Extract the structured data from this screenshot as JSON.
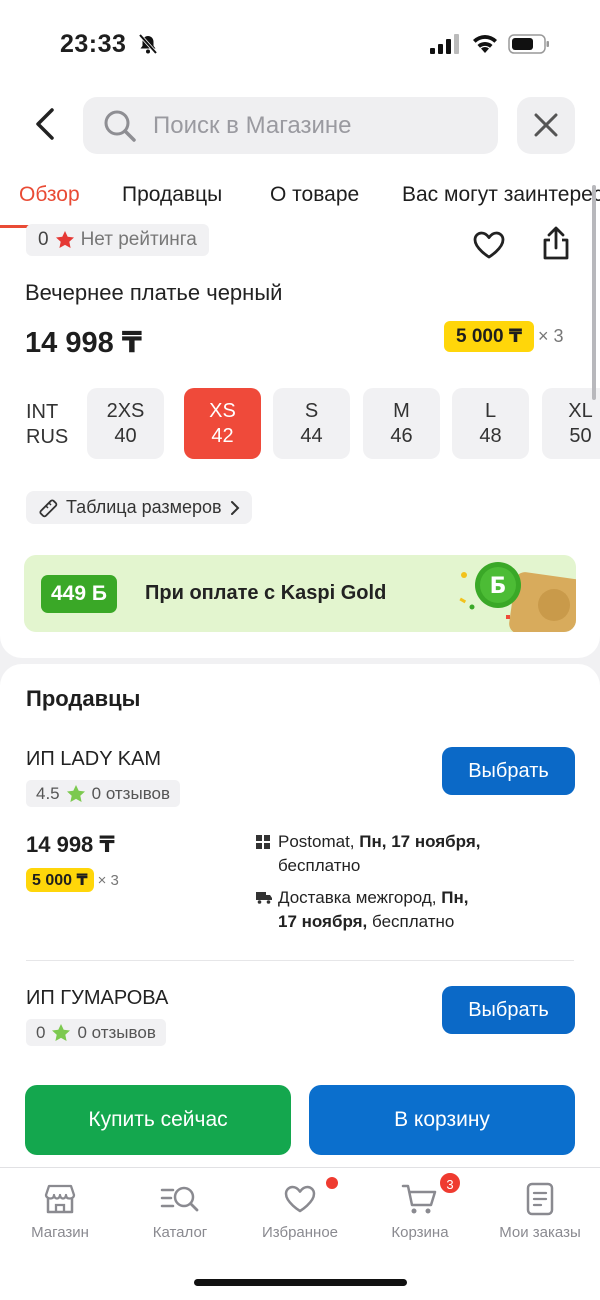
{
  "status_bar": {
    "time": "23:33"
  },
  "header": {
    "search_placeholder": "Поиск в Магазине"
  },
  "tabs": [
    {
      "label": "Обзор",
      "active": true
    },
    {
      "label": "Продавцы",
      "active": false
    },
    {
      "label": "О товаре",
      "active": false
    },
    {
      "label": "Вас могут заинтересовать",
      "active": false
    }
  ],
  "product": {
    "rating_count": "0",
    "rating_text": "Нет рейтинга",
    "title": "Вечернее платье черный",
    "price": "14 998 ₸",
    "installment_amount": "5 000 ₸",
    "installment_months": "× 3",
    "size_label_int": "INT",
    "size_label_rus": "RUS",
    "sizes": [
      {
        "int": "2XS",
        "rus": "40",
        "selected": false
      },
      {
        "int": "XS",
        "rus": "42",
        "selected": true
      },
      {
        "int": "S",
        "rus": "44",
        "selected": false
      },
      {
        "int": "M",
        "rus": "46",
        "selected": false
      },
      {
        "int": "L",
        "rus": "48",
        "selected": false
      },
      {
        "int": "XL",
        "rus": "50",
        "selected": false
      }
    ],
    "size_table_label": "Таблица размеров",
    "kaspi_bonus": "449 Б",
    "kaspi_text": "При оплате с Kaspi Gold"
  },
  "sellers": {
    "heading": "Продавцы",
    "choose_label": "Выбрать",
    "items": [
      {
        "name": "ИП LADY KAM",
        "rating": "4.5",
        "reviews": "0 отзывов",
        "price": "14 998 ₸",
        "installment_amount": "5 000 ₸",
        "installment_months": "× 3",
        "delivery1_a": "Postomat, ",
        "delivery1_b": "Пн, 17 ноября,",
        "delivery1_c": "бесплатно",
        "delivery2_a": "Доставка межгород, ",
        "delivery2_b": "Пн,",
        "delivery2_c": "17 ноября,",
        "delivery2_d": " бесплатно"
      },
      {
        "name": "ИП ГУМАРОВА",
        "rating": "0",
        "reviews": "0 отзывов"
      }
    ]
  },
  "actions": {
    "buy_now": "Купить сейчас",
    "to_cart": "В корзину"
  },
  "tabbar": {
    "items": [
      {
        "label": "Магазин",
        "icon": "store-icon"
      },
      {
        "label": "Каталог",
        "icon": "catalog-icon"
      },
      {
        "label": "Избранное",
        "icon": "heart-icon"
      },
      {
        "label": "Корзина",
        "icon": "cart-icon"
      },
      {
        "label": "Мои заказы",
        "icon": "orders-icon"
      }
    ],
    "cart_count": "3"
  },
  "colors": {
    "accent_red": "#e94b35",
    "primary_blue": "#0b69c7",
    "buy_green": "#14a74e",
    "installment_yellow": "#ffd60a"
  }
}
